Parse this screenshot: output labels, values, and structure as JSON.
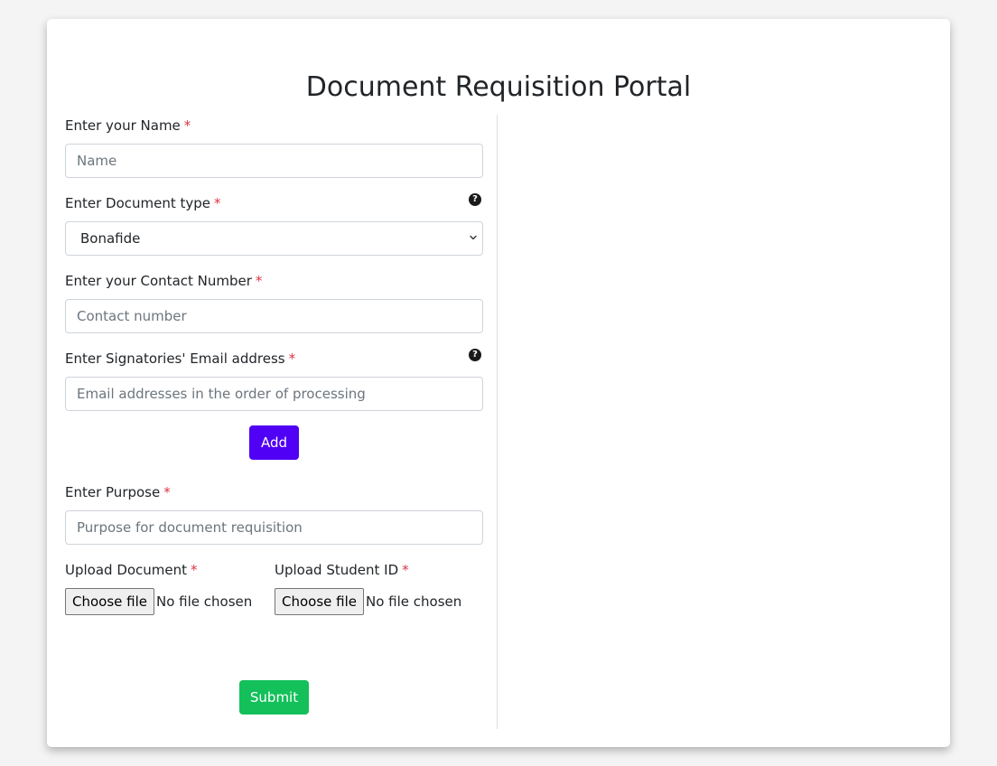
{
  "form": {
    "title": "Document Requisition Portal",
    "required_marker": "*",
    "name": {
      "label": "Enter your Name",
      "placeholder": "Name"
    },
    "document_type": {
      "label": "Enter Document type",
      "selected": "Bonafide"
    },
    "contact": {
      "label": "Enter your Contact Number",
      "placeholder": "Contact number"
    },
    "signatories": {
      "label": "Enter Signatories' Email address",
      "placeholder": "Email addresses in the order of processing"
    },
    "add_label": "Add",
    "purpose": {
      "label": "Enter Purpose",
      "placeholder": "Purpose for document requisition"
    },
    "upload_document": {
      "label": "Upload Document",
      "button": "Choose file",
      "status": "No file chosen"
    },
    "upload_student_id": {
      "label": "Upload Student ID",
      "button": "Choose file",
      "status": "No file chosen"
    },
    "submit_label": "Submit"
  },
  "icons": {
    "help": "question-circle-icon",
    "dropdown": "chevron-down-icon"
  },
  "colors": {
    "add_button": "#4f00f5",
    "submit_button": "#13c05a",
    "required": "#dc3545"
  }
}
